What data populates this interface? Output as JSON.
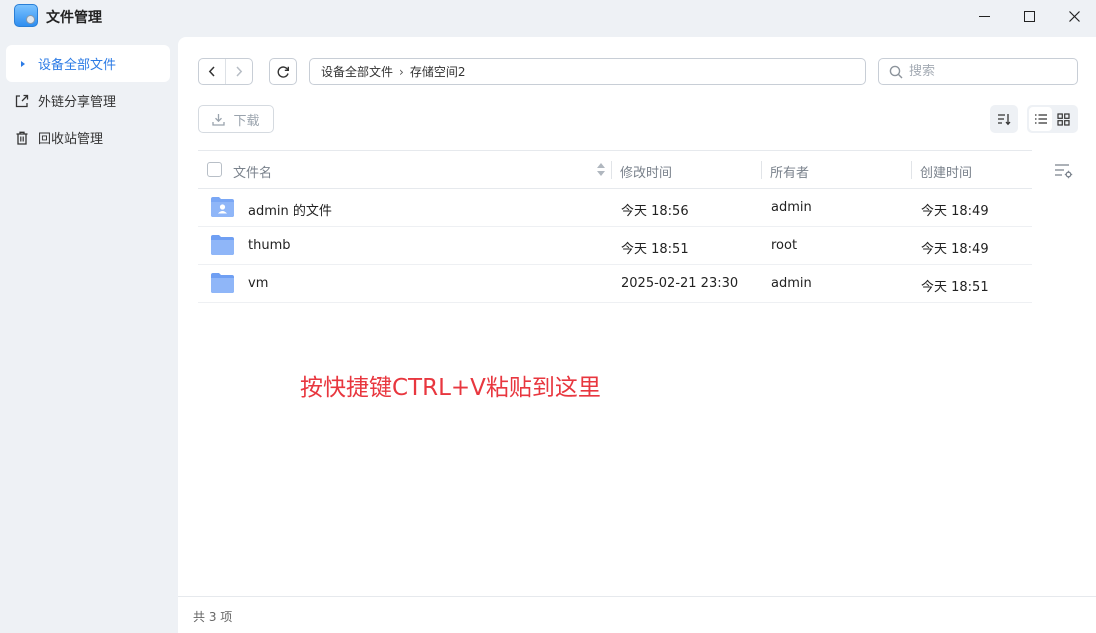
{
  "window": {
    "title": "文件管理",
    "app_icon": "file-manager-icon",
    "controls": [
      "minimize",
      "maximize",
      "close"
    ]
  },
  "sidebar": {
    "items": [
      {
        "label": "设备全部文件",
        "icon": "caret-right-icon",
        "active": true
      },
      {
        "label": "外链分享管理",
        "icon": "share-export-icon",
        "active": false
      },
      {
        "label": "回收站管理",
        "icon": "trash-icon",
        "active": false
      }
    ]
  },
  "toolbar": {
    "path": [
      "设备全部文件",
      "存储空间2"
    ],
    "path_separator": "›",
    "search_placeholder": "搜索",
    "download_label": "下载"
  },
  "table": {
    "columns": [
      "文件名",
      "修改时间",
      "所有者",
      "创建时间"
    ],
    "rows": [
      {
        "name": "admin 的文件",
        "modified": "今天 18:56",
        "owner": "admin",
        "created": "今天 18:49",
        "icon": "user-folder-icon"
      },
      {
        "name": "thumb",
        "modified": "今天 18:51",
        "owner": "root",
        "created": "今天 18:49",
        "icon": "folder-icon"
      },
      {
        "name": "vm",
        "modified": "2025-02-21 23:30",
        "owner": "admin",
        "created": "今天 18:51",
        "icon": "folder-icon"
      }
    ]
  },
  "paste_hint": "按快捷键CTRL+V粘贴到这里",
  "footer": {
    "count_text": "共 3 项"
  },
  "colors": {
    "accent": "#2c7be5",
    "hint": "#e8373f",
    "folder": "#7aa7f5"
  }
}
